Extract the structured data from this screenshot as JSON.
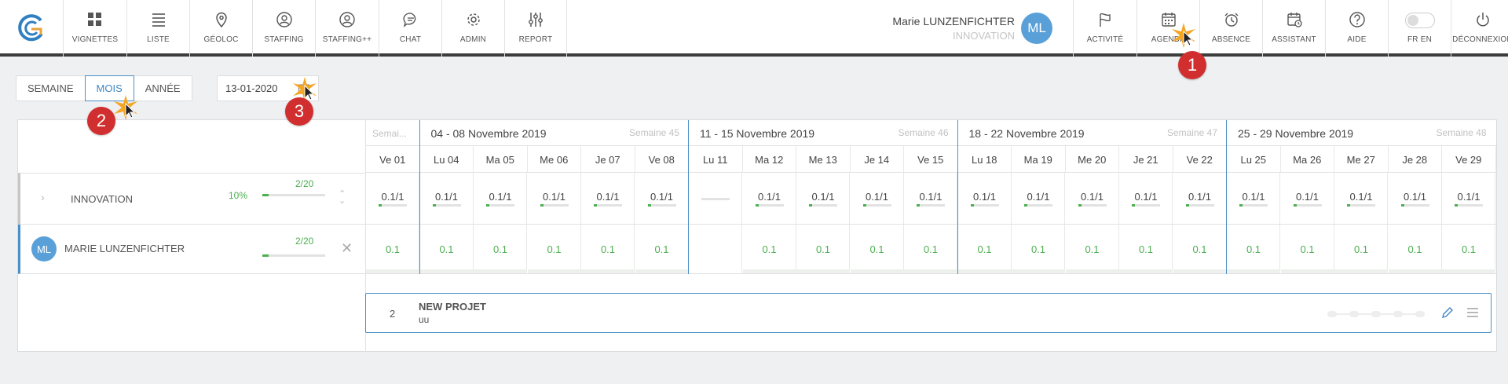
{
  "nav_left": [
    {
      "label": "VIGNETTES",
      "icon": "grid-icon"
    },
    {
      "label": "LISTE",
      "icon": "list-icon"
    },
    {
      "label": "GÉOLOC",
      "icon": "map-pin-icon"
    },
    {
      "label": "STAFFING",
      "icon": "user-circle-icon"
    },
    {
      "label": "STAFFING++",
      "icon": "user-circle-icon"
    },
    {
      "label": "CHAT",
      "icon": "chat-icon"
    },
    {
      "label": "ADMIN",
      "icon": "gear-icon"
    },
    {
      "label": "REPORT",
      "icon": "sliders-icon"
    }
  ],
  "user": {
    "name": "Marie LUNZENFICHTER",
    "org": "INNOVATION",
    "initials": "ML"
  },
  "nav_right": [
    {
      "label": "ACTIVITÉ",
      "icon": "flag-icon"
    },
    {
      "label": "AGENDA",
      "icon": "calendar-icon"
    },
    {
      "label": "ABSENCE",
      "icon": "alarm-icon"
    },
    {
      "label": "ASSISTANT",
      "icon": "calendar-clock-icon"
    },
    {
      "label": "AIDE",
      "icon": "help-icon"
    },
    {
      "label": "FR EN",
      "icon": "toggle-icon"
    },
    {
      "label": "DÉCONNEXION",
      "icon": "power-icon"
    }
  ],
  "view_toggle": {
    "week": "SEMAINE",
    "month": "MOIS",
    "year": "ANNÉE"
  },
  "date": "13-01-2020",
  "weeks": [
    {
      "label": "Semai...",
      "num": ""
    },
    {
      "label": "04 - 08 Novembre 2019",
      "num": "Semaine 45"
    },
    {
      "label": "11 - 15 Novembre 2019",
      "num": "Semaine 46"
    },
    {
      "label": "18 - 22 Novembre 2019",
      "num": "Semaine 47"
    },
    {
      "label": "25 - 29 Novembre 2019",
      "num": "Semaine 48"
    }
  ],
  "days": [
    "Ve 01",
    "Lu 04",
    "Ma 05",
    "Me 06",
    "Je 07",
    "Ve 08",
    "Lu 11",
    "Ma 12",
    "Me 13",
    "Je 14",
    "Ve 15",
    "Lu 18",
    "Ma 19",
    "Me 20",
    "Je 21",
    "Ve 22",
    "Lu 25",
    "Ma 26",
    "Me 27",
    "Je 28",
    "Ve 29"
  ],
  "team": {
    "name": "INNOVATION",
    "pct": "10%",
    "ratio": "2/20",
    "progress": 0.1,
    "cells": [
      "0.1/1",
      "0.1/1",
      "0.1/1",
      "0.1/1",
      "0.1/1",
      "0.1/1",
      "",
      "0.1/1",
      "0.1/1",
      "0.1/1",
      "0.1/1",
      "0.1/1",
      "0.1/1",
      "0.1/1",
      "0.1/1",
      "0.1/1",
      "0.1/1",
      "0.1/1",
      "0.1/1",
      "0.1/1",
      "0.1/1"
    ]
  },
  "member": {
    "initials": "ML",
    "name": "MARIE LUNZENFICHTER",
    "ratio": "2/20",
    "progress": 0.1,
    "cells": [
      "0.1",
      "0.1",
      "0.1",
      "0.1",
      "0.1",
      "0.1",
      "",
      "0.1",
      "0.1",
      "0.1",
      "0.1",
      "0.1",
      "0.1",
      "0.1",
      "0.1",
      "0.1",
      "0.1",
      "0.1",
      "0.1",
      "0.1",
      "0.1"
    ]
  },
  "project": {
    "num": "2",
    "title": "NEW PROJET",
    "subtitle": "uu"
  },
  "annotations": [
    "1",
    "2",
    "3"
  ],
  "colors": {
    "accent": "#4a90c8",
    "green": "#4caf50",
    "badge": "#d12f2f"
  }
}
